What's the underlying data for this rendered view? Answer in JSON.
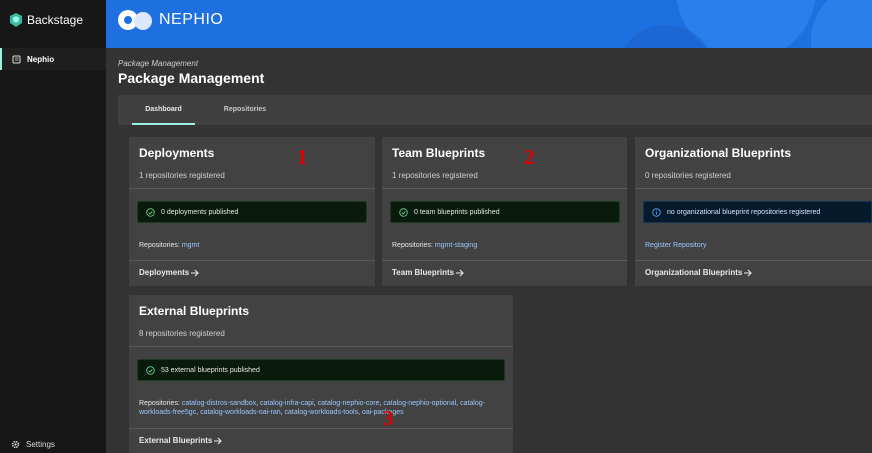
{
  "app": {
    "brand": "Backstage",
    "header_logo": "NEPHIO"
  },
  "sidebar": {
    "items": [
      {
        "label": "Nephio",
        "icon": "book-icon"
      }
    ],
    "settings_label": "Settings"
  },
  "page": {
    "breadcrumb": "Package Management",
    "title": "Package Management"
  },
  "tabs": [
    {
      "label": "Dashboard",
      "active": true
    },
    {
      "label": "Repositories",
      "active": false
    }
  ],
  "cards": {
    "deployments": {
      "title": "Deployments",
      "subtitle": "1 repositories registered",
      "status": "0 deployments published",
      "repos_label": "Repositories:",
      "repos": [
        "mgmt"
      ],
      "link": "Deployments"
    },
    "team": {
      "title": "Team Blueprints",
      "subtitle": "1 repositories registered",
      "status": "0 team blueprints published",
      "repos_label": "Repositories:",
      "repos": [
        "mgmt-staging"
      ],
      "link": "Team Blueprints"
    },
    "org": {
      "title": "Organizational Blueprints",
      "subtitle": "0 repositories registered",
      "status": "no organizational blueprint repositories registered",
      "register": "Register Repository",
      "link": "Organizational Blueprints"
    },
    "external": {
      "title": "External Blueprints",
      "subtitle": "8 repositories registered",
      "status": "53 external blueprints published",
      "repos_label": "Repositories:",
      "repos": [
        "catalog-distros-sandbox",
        "catalog-infra-capi",
        "catalog-nephio-core",
        "catalog-nephio-optional",
        "catalog-workloads-free5gc",
        "catalog-workloads-oai-ran",
        "catalog-workloads-tools",
        "oai-packages"
      ],
      "link": "External Blueprints"
    }
  },
  "markers": [
    "1",
    "2",
    "3"
  ],
  "colors": {
    "accent": "#9BF0E1",
    "header": "#1e6fe0",
    "link": "#9cc7ff",
    "success": "#6fd08a",
    "info": "#4ea3ff",
    "marker": "#e00000"
  }
}
